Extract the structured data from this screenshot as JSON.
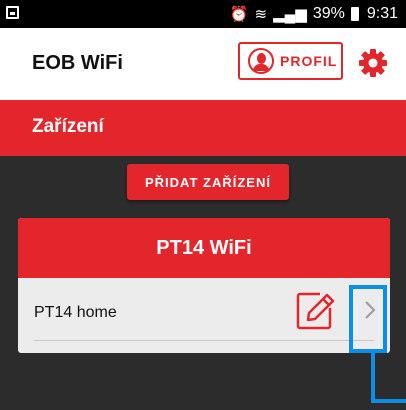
{
  "status_bar": {
    "battery": "39%",
    "time": "9:31"
  },
  "app_bar": {
    "title": "EOB WiFi",
    "profile_label": "PROFIL"
  },
  "section": {
    "title": "Zařízení"
  },
  "add_device_label": "PŘIDAT ZAŘÍZENÍ",
  "device_card": {
    "title": "PT14 WiFi",
    "device_name": "PT14 home"
  },
  "colors": {
    "accent": "#e3262c",
    "highlight": "#0b8fe6",
    "background": "#2c2c2c"
  }
}
